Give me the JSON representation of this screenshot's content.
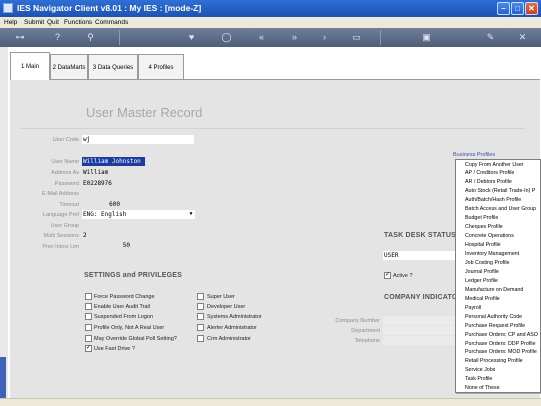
{
  "window": {
    "title": "IES Navigator Client v8.01 : My IES :      [mode-Z]",
    "min_glyph": "–",
    "max_glyph": "□",
    "close_glyph": "✕"
  },
  "menu": {
    "help": "Help",
    "submit": "Submit",
    "quit": "Quit",
    "functions": "Functions",
    "commands": "Commands"
  },
  "toolbar": {
    "icons": [
      "key-icon",
      "help-icon",
      "search-icon",
      "heart-icon",
      "refresh-icon",
      "first-icon",
      "last-icon",
      "next-icon",
      "print-icon",
      "lock-icon",
      "edit-icon",
      "close-icon"
    ]
  },
  "tabs": [
    {
      "label": "1 Main",
      "active": true
    },
    {
      "label": "2 DataMarts",
      "active": false
    },
    {
      "label": "3 Data Queries",
      "active": false
    },
    {
      "label": "4 Profiles",
      "active": false
    }
  ],
  "page": {
    "heading": "User Master Record"
  },
  "user_code": {
    "label": "User Code",
    "value": "wj"
  },
  "fields": {
    "user_name": {
      "label": "User Name",
      "value": "William Johnston"
    },
    "address_as": {
      "label": "Address As",
      "value": "William"
    },
    "password": {
      "label": "Password",
      "value": "E0228976"
    },
    "email": {
      "label": "E-Mail Address",
      "value": ""
    },
    "timeout": {
      "label": "Timeout",
      "value": "600"
    },
    "language": {
      "label": "Language Pref",
      "value": "ENG: English"
    },
    "user_group": {
      "label": "User Group",
      "value": ""
    },
    "multi_sessions": {
      "label": "Multi Sessions",
      "value": "2"
    },
    "prev_inbox_lim": {
      "label": "Prev Inbox Lim",
      "value": "50"
    }
  },
  "settings": {
    "title": "SETTINGS and PRIVILEGES",
    "left": [
      {
        "label": "Force Password Change",
        "checked": false
      },
      {
        "label": "Enable User Audit Trail",
        "checked": false
      },
      {
        "label": "Suspended From Logon",
        "checked": false
      },
      {
        "label": "Profile Only, Not A Real User",
        "checked": false
      },
      {
        "label": "May Override Global Poll Setting?",
        "checked": false
      },
      {
        "label": "Use Fast Drive ?",
        "checked": true
      }
    ],
    "right": [
      {
        "label": "Super User",
        "checked": false
      },
      {
        "label": "Developer User",
        "checked": false
      },
      {
        "label": "Systems Administrator",
        "checked": false
      },
      {
        "label": "Alerter Administrator",
        "checked": false
      },
      {
        "label": "Crm Administrator",
        "checked": false
      }
    ]
  },
  "task_desk": {
    "title": "TASK DESK STATUS",
    "value": "USER",
    "active_label": "Active ?",
    "active_checked": true
  },
  "company": {
    "title": "COMPANY INDICATOR",
    "number_label": "Company Number",
    "department_label": "Department",
    "telephone_label": "Telephone"
  },
  "business_profiles": {
    "link": "Business Profiles",
    "items": [
      "Copy From Another User",
      "AP / Creditors Profile",
      "AR / Debtors Profile",
      "Auto Stock (Retail Trade-In) P",
      "Auth/Batch/Hash Profile",
      "Batch Access and User Group",
      "Budget Profile",
      "Cheques Profile",
      "Concrete Operations",
      "Hospital Profile",
      "Inventory Management",
      "Job Costing Profile",
      "Journal Profile",
      "Ledger Profile",
      "Manufacture on Demand",
      "Medical Profile",
      "Payroll",
      "Personal Authority Code",
      "Purchase Request Profile",
      "Purchase Orders: CP and ASO",
      "Purchase Orders: DDP Profile",
      "Purchase Orders: MOD Profile",
      "Retail Processing Profile",
      "Service Jobs",
      "Task Profile",
      "None of These"
    ]
  }
}
